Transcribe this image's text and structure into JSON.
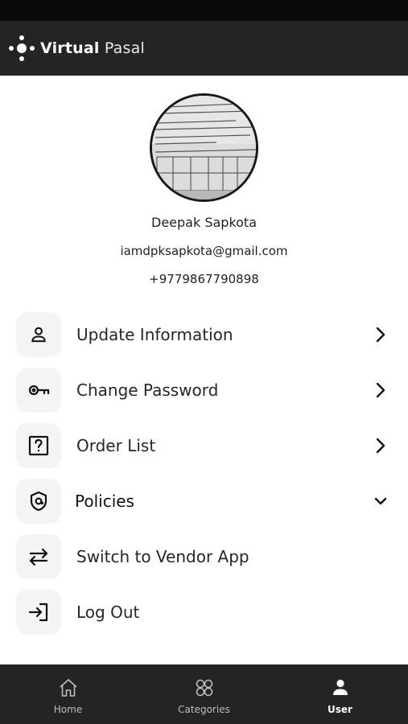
{
  "app": {
    "brand_bold": "Virtual",
    "brand_light": "Pasal"
  },
  "profile": {
    "name": "Deepak Sapkota",
    "email": "iamdpksapkota@gmail.com",
    "phone": "+9779867790898"
  },
  "menu": [
    {
      "label": "Update Information",
      "icon": "user-icon",
      "trailing": "chevron-right"
    },
    {
      "label": "Change Password",
      "icon": "key-icon",
      "trailing": "chevron-right"
    },
    {
      "label": "Order List",
      "icon": "question-box-icon",
      "trailing": "chevron-right"
    },
    {
      "label": "Policies",
      "icon": "shield-icon",
      "trailing": "chevron-down"
    },
    {
      "label": "Switch to Vendor App",
      "icon": "swap-icon",
      "trailing": ""
    },
    {
      "label": "Log Out",
      "icon": "logout-icon",
      "trailing": ""
    }
  ],
  "bottom_nav": [
    {
      "label": "Home",
      "icon": "home-icon",
      "active": false
    },
    {
      "label": "Categories",
      "icon": "categories-icon",
      "active": false
    },
    {
      "label": "User",
      "icon": "user-icon",
      "active": true
    }
  ],
  "colors": {
    "app_bar": "#242424",
    "status_bar": "#0a0a0a",
    "icon_tile": "#f4f4f4",
    "nav_active": "#ffffff",
    "nav_inactive": "#bdbdbd"
  }
}
